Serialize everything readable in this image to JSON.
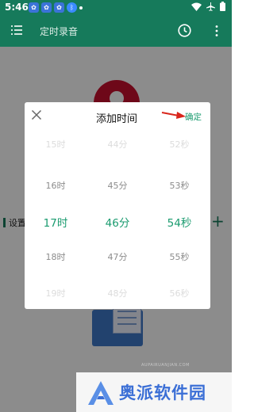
{
  "status_bar": {
    "time": "5:46",
    "notifications": [
      "paw-icon",
      "paw-icon",
      "paw-icon",
      "bluetooth-icon",
      "dot-icon"
    ],
    "system_icons": [
      "wifi-icon",
      "airplane-icon",
      "battery-icon"
    ]
  },
  "app_bar": {
    "title": "定时录音",
    "icons": [
      "menu-icon",
      "clock-icon",
      "more-vert-icon"
    ]
  },
  "background": {
    "side_label": "设置",
    "add_symbol": "+"
  },
  "dialog": {
    "title": "添加时间",
    "confirm_label": "确定",
    "close_icon": "close-icon",
    "hours": [
      "15时",
      "16时",
      "17时",
      "18时",
      "19时"
    ],
    "minutes": [
      "44分",
      "45分",
      "46分",
      "47分",
      "48分"
    ],
    "seconds": [
      "52秒",
      "53秒",
      "54秒",
      "55秒",
      "56秒"
    ],
    "selected_index": 2
  },
  "watermark": {
    "text": "奥派软件园",
    "url": "AUPAIRUANJIAN.COM"
  },
  "colors": {
    "primary": "#167a5b",
    "accent": "#1a9b6f",
    "annotation_arrow": "#d9261c",
    "watermark": "#3b6fd6"
  }
}
